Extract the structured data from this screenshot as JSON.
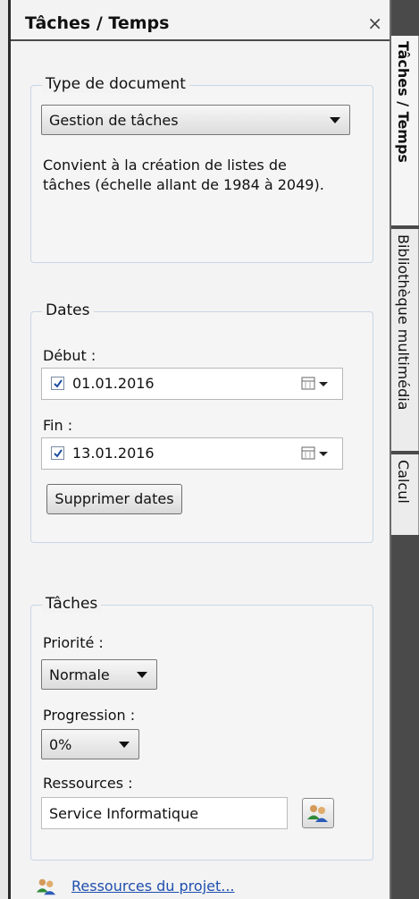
{
  "panel": {
    "title": "Tâches / Temps",
    "close_glyph": "×"
  },
  "doc_type": {
    "legend": "Type de document",
    "selected": "Gestion de tâches",
    "description_line1": "Convient à la création de listes de",
    "description_line2": "tâches (échelle allant de 1984 à 2049)."
  },
  "dates": {
    "legend": "Dates",
    "start_label": "Début :",
    "start_value": "01.01.2016",
    "start_checked": true,
    "end_label": "Fin :",
    "end_value": "13.01.2016",
    "end_checked": true,
    "clear_button": "Supprimer dates"
  },
  "tasks": {
    "legend": "Tâches",
    "priority_label": "Priorité :",
    "priority_value": "Normale",
    "progress_label": "Progression :",
    "progress_value": "0%",
    "resources_label": "Ressources :",
    "resources_value": "Service Informatique"
  },
  "footer": {
    "project_resources_link": "Ressources du projet..."
  },
  "tabs": [
    {
      "label": "Tâches / Temps",
      "active": true
    },
    {
      "label": "Bibliothèque multimédia",
      "active": false
    },
    {
      "label": "Calcul",
      "active": false
    }
  ]
}
